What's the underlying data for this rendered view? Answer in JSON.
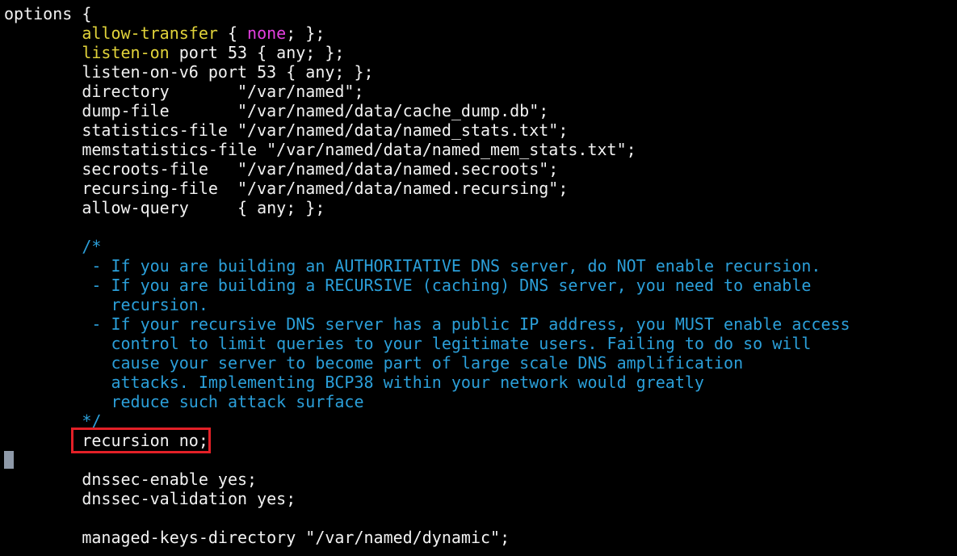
{
  "terminal": {
    "colors": {
      "background": "#000000",
      "plain": "#f2f2f2",
      "keyword": "#e1d33a",
      "none_value": "#e33fe0",
      "comment": "#2b9fd9",
      "highlight_box": "#e32027",
      "cursor": "#8e99a8"
    },
    "lines": [
      {
        "segments": [
          {
            "kind": "plain",
            "text": "options {"
          }
        ]
      },
      {
        "segments": [
          {
            "kind": "plain",
            "text": "        "
          },
          {
            "kind": "keyword",
            "text": "allow-transfer"
          },
          {
            "kind": "plain",
            "text": " { "
          },
          {
            "kind": "none",
            "text": "none"
          },
          {
            "kind": "plain",
            "text": "; };"
          }
        ]
      },
      {
        "segments": [
          {
            "kind": "plain",
            "text": "        "
          },
          {
            "kind": "keyword",
            "text": "listen-on"
          },
          {
            "kind": "plain",
            "text": " port 53 { any; };"
          }
        ]
      },
      {
        "segments": [
          {
            "kind": "plain",
            "text": "        listen-on-v6 port 53 { any; };"
          }
        ]
      },
      {
        "segments": [
          {
            "kind": "plain",
            "text": "        directory       \"/var/named\";"
          }
        ]
      },
      {
        "segments": [
          {
            "kind": "plain",
            "text": "        dump-file       \"/var/named/data/cache_dump.db\";"
          }
        ]
      },
      {
        "segments": [
          {
            "kind": "plain",
            "text": "        statistics-file \"/var/named/data/named_stats.txt\";"
          }
        ]
      },
      {
        "segments": [
          {
            "kind": "plain",
            "text": "        memstatistics-file \"/var/named/data/named_mem_stats.txt\";"
          }
        ]
      },
      {
        "segments": [
          {
            "kind": "plain",
            "text": "        secroots-file   \"/var/named/data/named.secroots\";"
          }
        ]
      },
      {
        "segments": [
          {
            "kind": "plain",
            "text": "        recursing-file  \"/var/named/data/named.recursing\";"
          }
        ]
      },
      {
        "segments": [
          {
            "kind": "plain",
            "text": "        allow-query     { any; };"
          }
        ]
      },
      {
        "segments": []
      },
      {
        "segments": [
          {
            "kind": "comment",
            "text": "        /*"
          }
        ]
      },
      {
        "segments": [
          {
            "kind": "comment",
            "text": "         - If you are building an AUTHORITATIVE DNS server, do NOT enable recursion."
          }
        ]
      },
      {
        "segments": [
          {
            "kind": "comment",
            "text": "         - If you are building a RECURSIVE (caching) DNS server, you need to enable"
          }
        ]
      },
      {
        "segments": [
          {
            "kind": "comment",
            "text": "           recursion."
          }
        ]
      },
      {
        "segments": [
          {
            "kind": "comment",
            "text": "         - If your recursive DNS server has a public IP address, you MUST enable access"
          }
        ]
      },
      {
        "segments": [
          {
            "kind": "comment",
            "text": "           control to limit queries to your legitimate users. Failing to do so will"
          }
        ]
      },
      {
        "segments": [
          {
            "kind": "comment",
            "text": "           cause your server to become part of large scale DNS amplification"
          }
        ]
      },
      {
        "segments": [
          {
            "kind": "comment",
            "text": "           attacks. Implementing BCP38 within your network would greatly"
          }
        ]
      },
      {
        "segments": [
          {
            "kind": "comment",
            "text": "           reduce such attack surface"
          }
        ]
      },
      {
        "segments": [
          {
            "kind": "comment",
            "text": "        */"
          }
        ]
      },
      {
        "segments": [
          {
            "kind": "plain",
            "text": "        recursion no;"
          }
        ]
      },
      {
        "segments": []
      },
      {
        "segments": [
          {
            "kind": "plain",
            "text": "        dnssec-enable yes;"
          }
        ]
      },
      {
        "segments": [
          {
            "kind": "plain",
            "text": "        dnssec-validation yes;"
          }
        ]
      },
      {
        "segments": []
      },
      {
        "segments": [
          {
            "kind": "plain",
            "text": "        managed-keys-directory \"/var/named/dynamic\";"
          }
        ]
      }
    ]
  }
}
